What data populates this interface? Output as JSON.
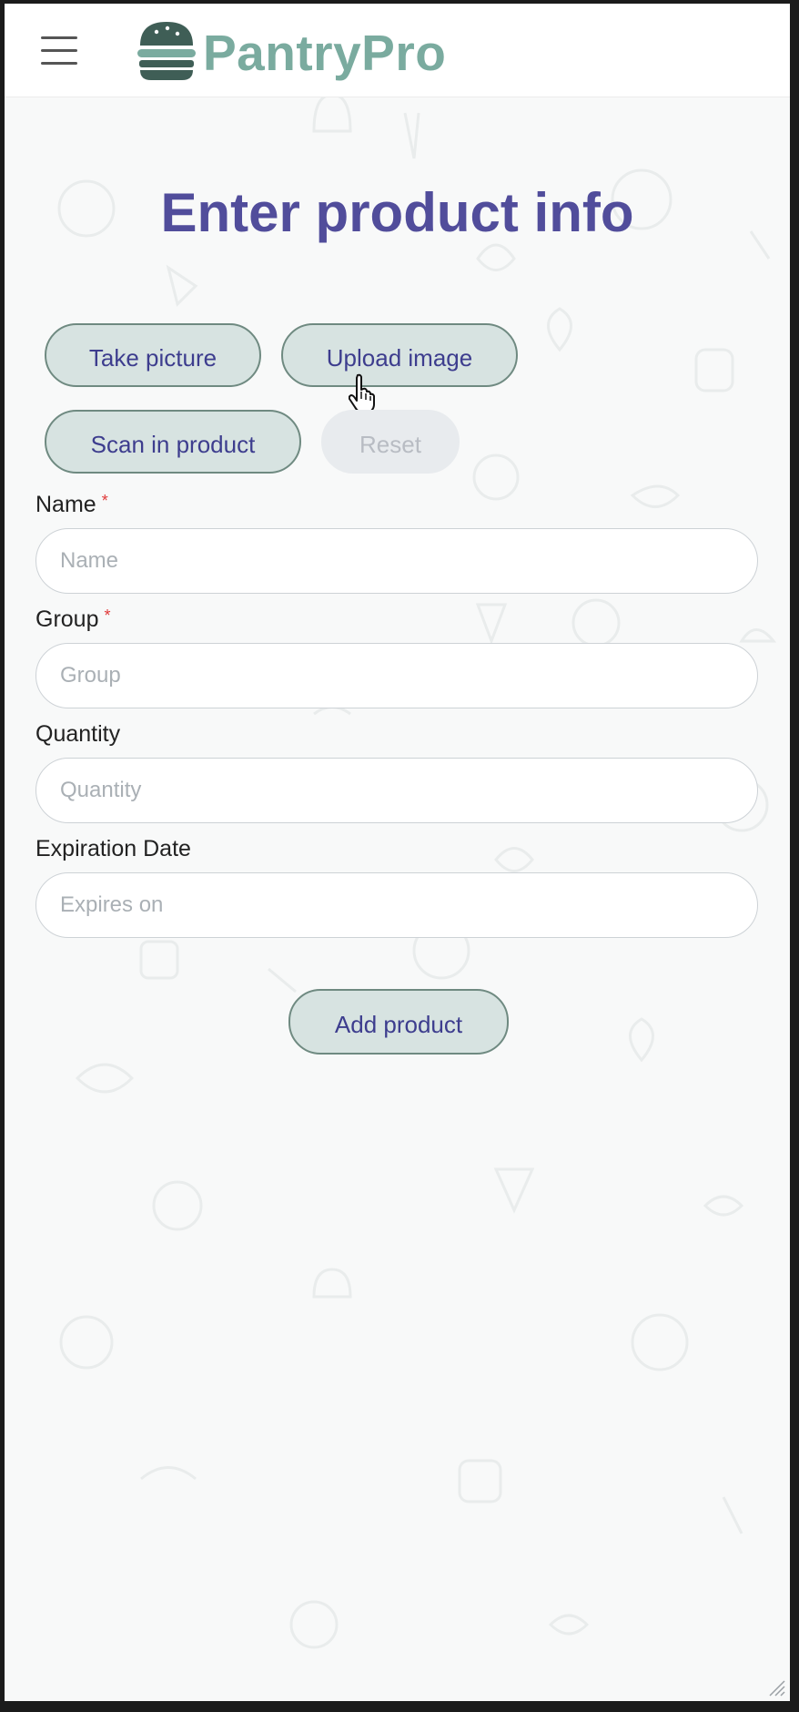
{
  "app": {
    "name": "PantryPro",
    "brand_color": "#7aab9f",
    "logo_icon": "burger-icon"
  },
  "header": {
    "menu_icon": "hamburger-menu-icon"
  },
  "page": {
    "title": "Enter product info",
    "title_color": "#514d9b"
  },
  "actions": {
    "take_picture": "Take picture",
    "upload_image": "Upload image",
    "scan_product": "Scan in product",
    "reset": "Reset"
  },
  "form": {
    "name": {
      "label": "Name",
      "placeholder": "Name",
      "required": true
    },
    "group": {
      "label": "Group",
      "placeholder": "Group",
      "required": true
    },
    "quantity": {
      "label": "Quantity",
      "placeholder": "Quantity",
      "required": false
    },
    "expiration": {
      "label": "Expiration Date",
      "placeholder": "Expires on",
      "required": false
    },
    "required_marker": "*",
    "submit": "Add product"
  },
  "colors": {
    "button_bg": "#d7e3e1",
    "button_text": "#3d3d8e",
    "disabled_bg": "#e8ebee"
  }
}
